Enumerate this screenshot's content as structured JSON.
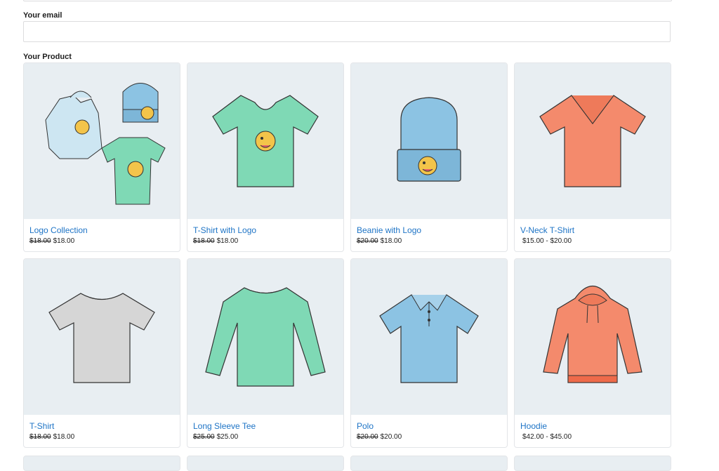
{
  "form": {
    "email_label": "Your email",
    "email_value": "",
    "product_label": "Your Product"
  },
  "colors": {
    "link": "#1e74c6",
    "image_bg": "#e8eef2",
    "green": "#7fd9b5",
    "blue": "#8cc3e3",
    "coral": "#f48a6c",
    "grey": "#d6d6d6"
  },
  "products": [
    {
      "name": "Logo Collection",
      "old_price": "$18.00",
      "price": "$18.00",
      "icon": "logo-collection-icon"
    },
    {
      "name": "T-Shirt with Logo",
      "old_price": "$18.00",
      "price": "$18.00",
      "icon": "tshirt-logo-icon"
    },
    {
      "name": "Beanie with Logo",
      "old_price": "$20.00",
      "price": "$18.00",
      "icon": "beanie-icon"
    },
    {
      "name": "V-Neck T-Shirt",
      "old_price": "",
      "price": "$15.00 - $20.00",
      "icon": "vneck-icon"
    },
    {
      "name": "T-Shirt",
      "old_price": "$18.00",
      "price": "$18.00",
      "icon": "tshirt-icon"
    },
    {
      "name": "Long Sleeve Tee",
      "old_price": "$25.00",
      "price": "$25.00",
      "icon": "long-sleeve-icon"
    },
    {
      "name": "Polo",
      "old_price": "$20.00",
      "price": "$20.00",
      "icon": "polo-icon"
    },
    {
      "name": "Hoodie",
      "old_price": "",
      "price": "$42.00 - $45.00",
      "icon": "hoodie-icon"
    }
  ]
}
